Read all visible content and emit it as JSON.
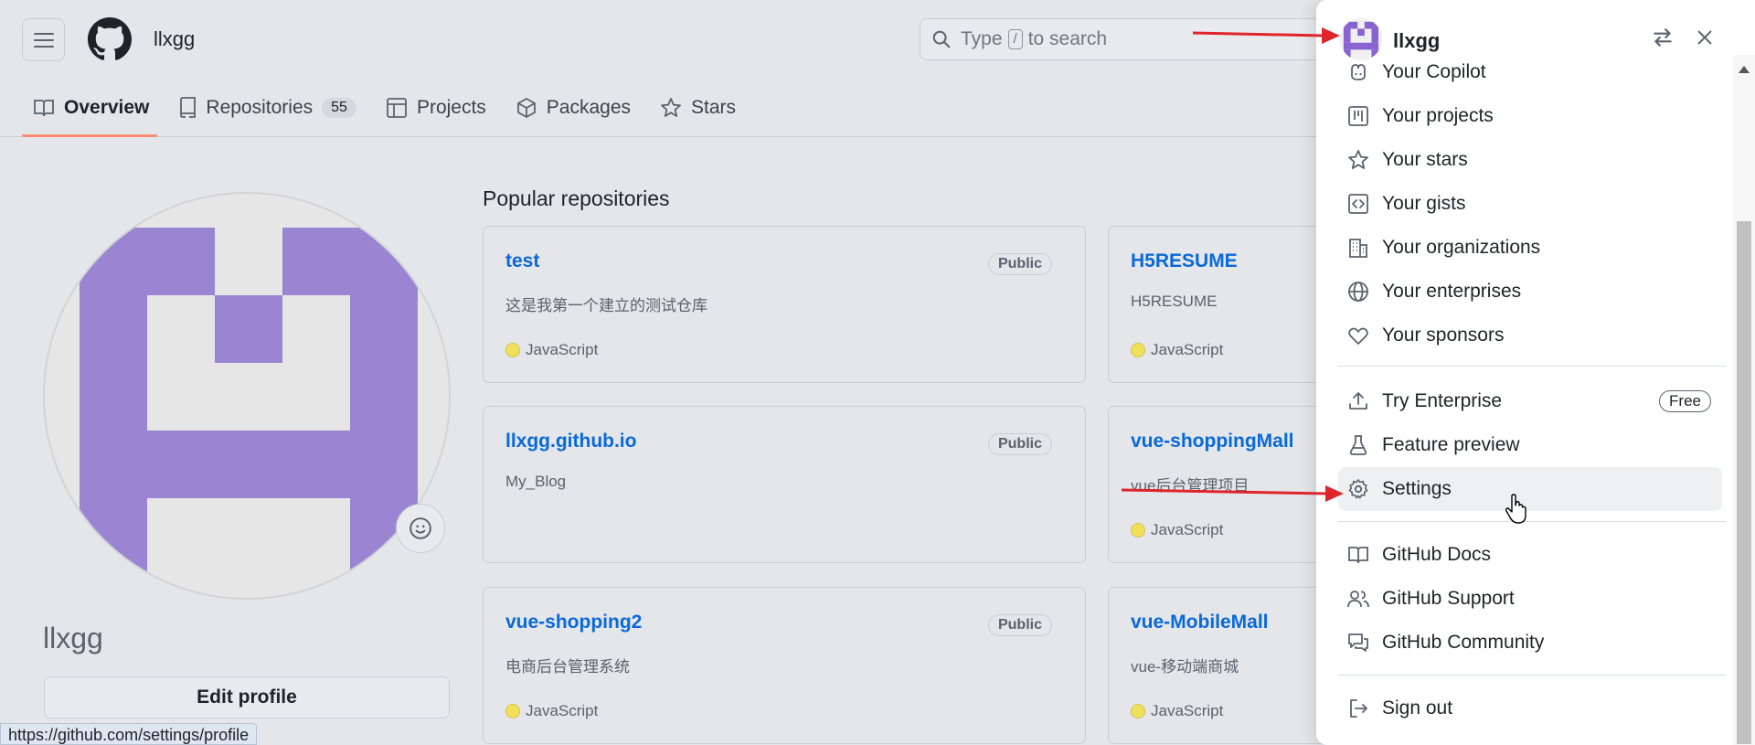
{
  "header": {
    "username": "llxgg",
    "search_prefix": "Type",
    "search_key": "/",
    "search_suffix": "to search"
  },
  "tabs": [
    {
      "label": "Overview",
      "active": true
    },
    {
      "label": "Repositories",
      "count": "55"
    },
    {
      "label": "Projects"
    },
    {
      "label": "Packages"
    },
    {
      "label": "Stars"
    }
  ],
  "profile": {
    "name": "llxgg",
    "edit_label": "Edit profile",
    "status_url": "https://github.com/settings/profile"
  },
  "popular": {
    "title": "Popular repositories",
    "repos": [
      {
        "name": "test",
        "badge": "Public",
        "desc": "这是我第一个建立的测试仓库",
        "lang": "JavaScript"
      },
      {
        "name": "H5RESUME",
        "badge": "",
        "desc": "H5RESUME",
        "lang": "JavaScript"
      },
      {
        "name": "llxgg.github.io",
        "badge": "Public",
        "desc": "My_Blog",
        "lang": ""
      },
      {
        "name": "vue-shoppingMall",
        "badge": "",
        "desc": "vue后台管理项目",
        "lang": "JavaScript"
      },
      {
        "name": "vue-shopping2",
        "badge": "Public",
        "desc": "电商后台管理系统",
        "lang": "JavaScript"
      },
      {
        "name": "vue-MobileMall",
        "badge": "",
        "desc": "vue-移动端商城",
        "lang": "JavaScript"
      }
    ]
  },
  "menu": {
    "username": "llxgg",
    "items": [
      {
        "label": "Your Copilot",
        "icon": "copilot-icon"
      },
      {
        "label": "Your projects",
        "icon": "project-icon"
      },
      {
        "label": "Your stars",
        "icon": "star-icon"
      },
      {
        "label": "Your gists",
        "icon": "code-square-icon"
      },
      {
        "label": "Your organizations",
        "icon": "organization-icon"
      },
      {
        "label": "Your enterprises",
        "icon": "globe-icon"
      },
      {
        "label": "Your sponsors",
        "icon": "heart-icon"
      },
      {
        "label": "Try Enterprise",
        "icon": "upload-icon",
        "badge": "Free"
      },
      {
        "label": "Feature preview",
        "icon": "beaker-icon"
      },
      {
        "label": "Settings",
        "icon": "gear-icon"
      },
      {
        "label": "GitHub Docs",
        "icon": "book-icon"
      },
      {
        "label": "GitHub Support",
        "icon": "people-icon"
      },
      {
        "label": "GitHub Community",
        "icon": "comment-discussion-icon"
      },
      {
        "label": "Sign out",
        "icon": "sign-out-icon"
      }
    ]
  },
  "colors": {
    "accent_link": "#0969da",
    "avatar_purple": "#9b84d1",
    "tab_underline": "#fd8c73",
    "annotation_arrow": "#e0242c",
    "js_dot": "#f1e05a"
  }
}
